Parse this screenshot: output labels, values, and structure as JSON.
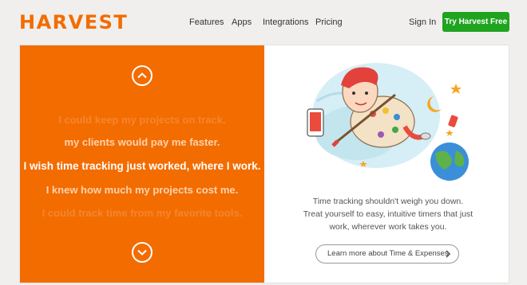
{
  "header": {
    "logo": "HARVEST",
    "nav": [
      "Features",
      "Apps",
      "Integrations",
      "Pricing"
    ],
    "sign_in": "Sign In",
    "cta": "Try Harvest Free"
  },
  "hero": {
    "lines": [
      "I could keep my projects on track.",
      "my clients would pay me faster.",
      "I wish time tracking just worked, where I work.",
      "I knew how much my projects cost me.",
      "I could track time from my favorite tools."
    ],
    "description": [
      "Time tracking shouldn't weigh you down.",
      "Treat yourself to easy, intuitive timers that just",
      "work, wherever work takes you."
    ],
    "learn_more": "Learn more about Time & Expenses"
  },
  "colors": {
    "brand_orange": "#f36c00",
    "cta_green": "#1fa41f"
  }
}
